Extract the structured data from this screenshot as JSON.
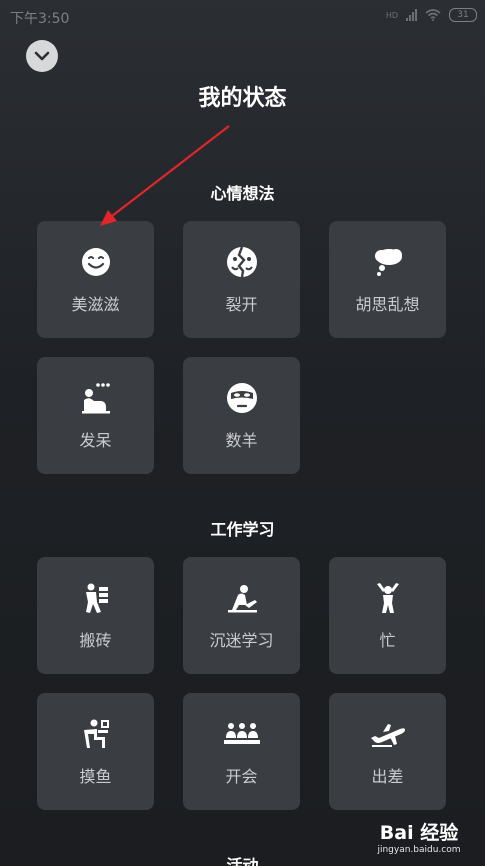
{
  "status_bar": {
    "time": "下午3:50",
    "network": "HD",
    "battery": "31"
  },
  "header": {
    "close_icon": "chevron-down-icon",
    "title": "我的状态"
  },
  "sections": [
    {
      "title": "心情想法",
      "items": [
        {
          "label": "美滋滋",
          "icon": "smile-face-icon"
        },
        {
          "label": "裂开",
          "icon": "cracked-face-icon"
        },
        {
          "label": "胡思乱想",
          "icon": "thought-cloud-icon"
        },
        {
          "label": "发呆",
          "icon": "daydream-person-icon"
        },
        {
          "label": "数羊",
          "icon": "sleep-mask-face-icon"
        }
      ]
    },
    {
      "title": "工作学习",
      "items": [
        {
          "label": "搬砖",
          "icon": "carrying-bricks-icon"
        },
        {
          "label": "沉迷学习",
          "icon": "studying-person-icon"
        },
        {
          "label": "忙",
          "icon": "busy-person-icon"
        },
        {
          "label": "摸鱼",
          "icon": "slacking-person-icon"
        },
        {
          "label": "开会",
          "icon": "meeting-people-icon"
        },
        {
          "label": "出差",
          "icon": "airplane-icon"
        }
      ]
    },
    {
      "title": "活动"
    }
  ],
  "watermark": {
    "logo": "Bai 经验",
    "url": "jingyan.baidu.com"
  },
  "colors": {
    "background": "#1e2125",
    "tile": "#3a3d42",
    "annotation_arrow": "#e0262b"
  }
}
